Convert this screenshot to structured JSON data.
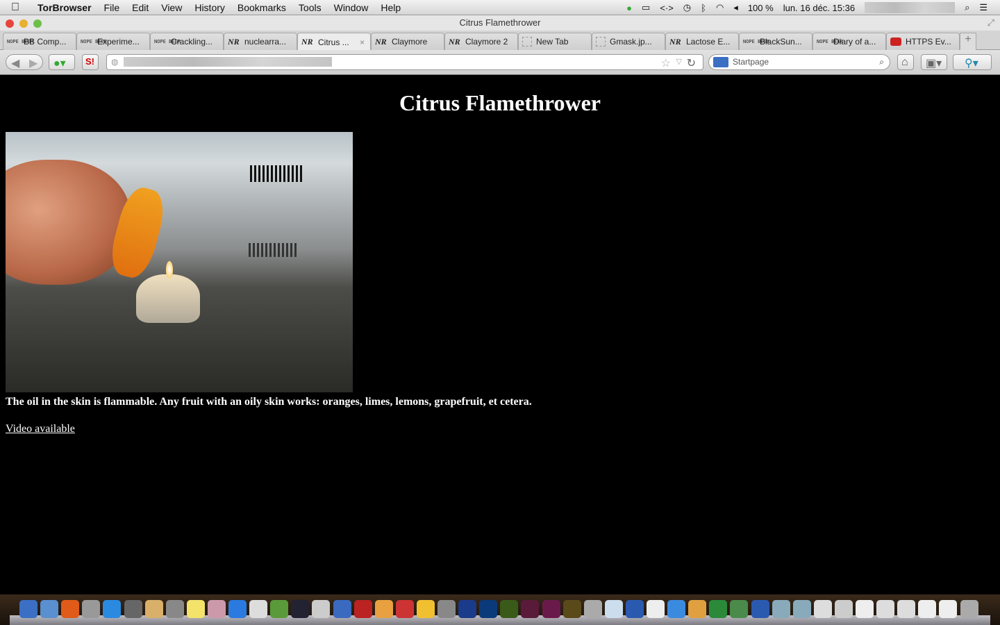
{
  "menubar": {
    "app": "TorBrowser",
    "items": [
      "File",
      "Edit",
      "View",
      "History",
      "Bookmarks",
      "Tools",
      "Window",
      "Help"
    ],
    "battery": "100 %",
    "datetime": "lun. 16 déc.  15:36"
  },
  "window": {
    "title": "Citrus Flamethrower"
  },
  "tabs": [
    {
      "label": "BB Comp...",
      "icon": "nope-beer"
    },
    {
      "label": "Experime...",
      "icon": "nope-beer"
    },
    {
      "label": "Crackling...",
      "icon": "nope-beer"
    },
    {
      "label": "nuclearra...",
      "icon": "nr"
    },
    {
      "label": "Citrus ...",
      "icon": "nr",
      "active": true
    },
    {
      "label": "Claymore",
      "icon": "nr"
    },
    {
      "label": "Claymore 2",
      "icon": "nr"
    },
    {
      "label": "New Tab",
      "icon": "blank"
    },
    {
      "label": "Gmask.jp...",
      "icon": "blank"
    },
    {
      "label": "Lactose E...",
      "icon": "nr"
    },
    {
      "label": "BlackSun...",
      "icon": "nope-beer"
    },
    {
      "label": "Diary of a...",
      "icon": "nope-beer"
    },
    {
      "label": "HTTPS Ev...",
      "icon": "https"
    }
  ],
  "favicon_text": {
    "nope-beer": "NOPE BEER",
    "nr": "NR"
  },
  "search": {
    "placeholder": "Startpage"
  },
  "page": {
    "heading": "Citrus Flamethrower",
    "caption": "The oil in the skin is flammable. Any fruit with an oily skin works: oranges, limes, lemons, grapefruit, et cetera.",
    "link": "Video available"
  },
  "dock": [
    "#3a6fc4",
    "#5a8fd0",
    "#e05a1a",
    "#999",
    "#2a8ae0",
    "#666",
    "#d9b06a",
    "#888",
    "#f3e36a",
    "#c9a",
    "#2a7ae0",
    "#ddd",
    "#5a9a3a",
    "#223",
    "#ccc",
    "#3a6ac0",
    "#b22",
    "#e8a040",
    "#c33",
    "#f0c030",
    "#888",
    "#1a3a8a",
    "#0a3a7a",
    "#3a5a1a",
    "#5a1a3a",
    "#6a1a4a",
    "#5a4a1a",
    "#aaa",
    "#cde",
    "#2a5ab0",
    "#eee",
    "#3a8ae0",
    "#e0a040",
    "#2a8a3a",
    "#4a8a4a",
    "#2a5ab0",
    "#8ab",
    "#8ab",
    "#ddd",
    "#ccc",
    "#eee",
    "#ddd",
    "#ddd",
    "#eee",
    "#eee",
    "#aaa"
  ]
}
